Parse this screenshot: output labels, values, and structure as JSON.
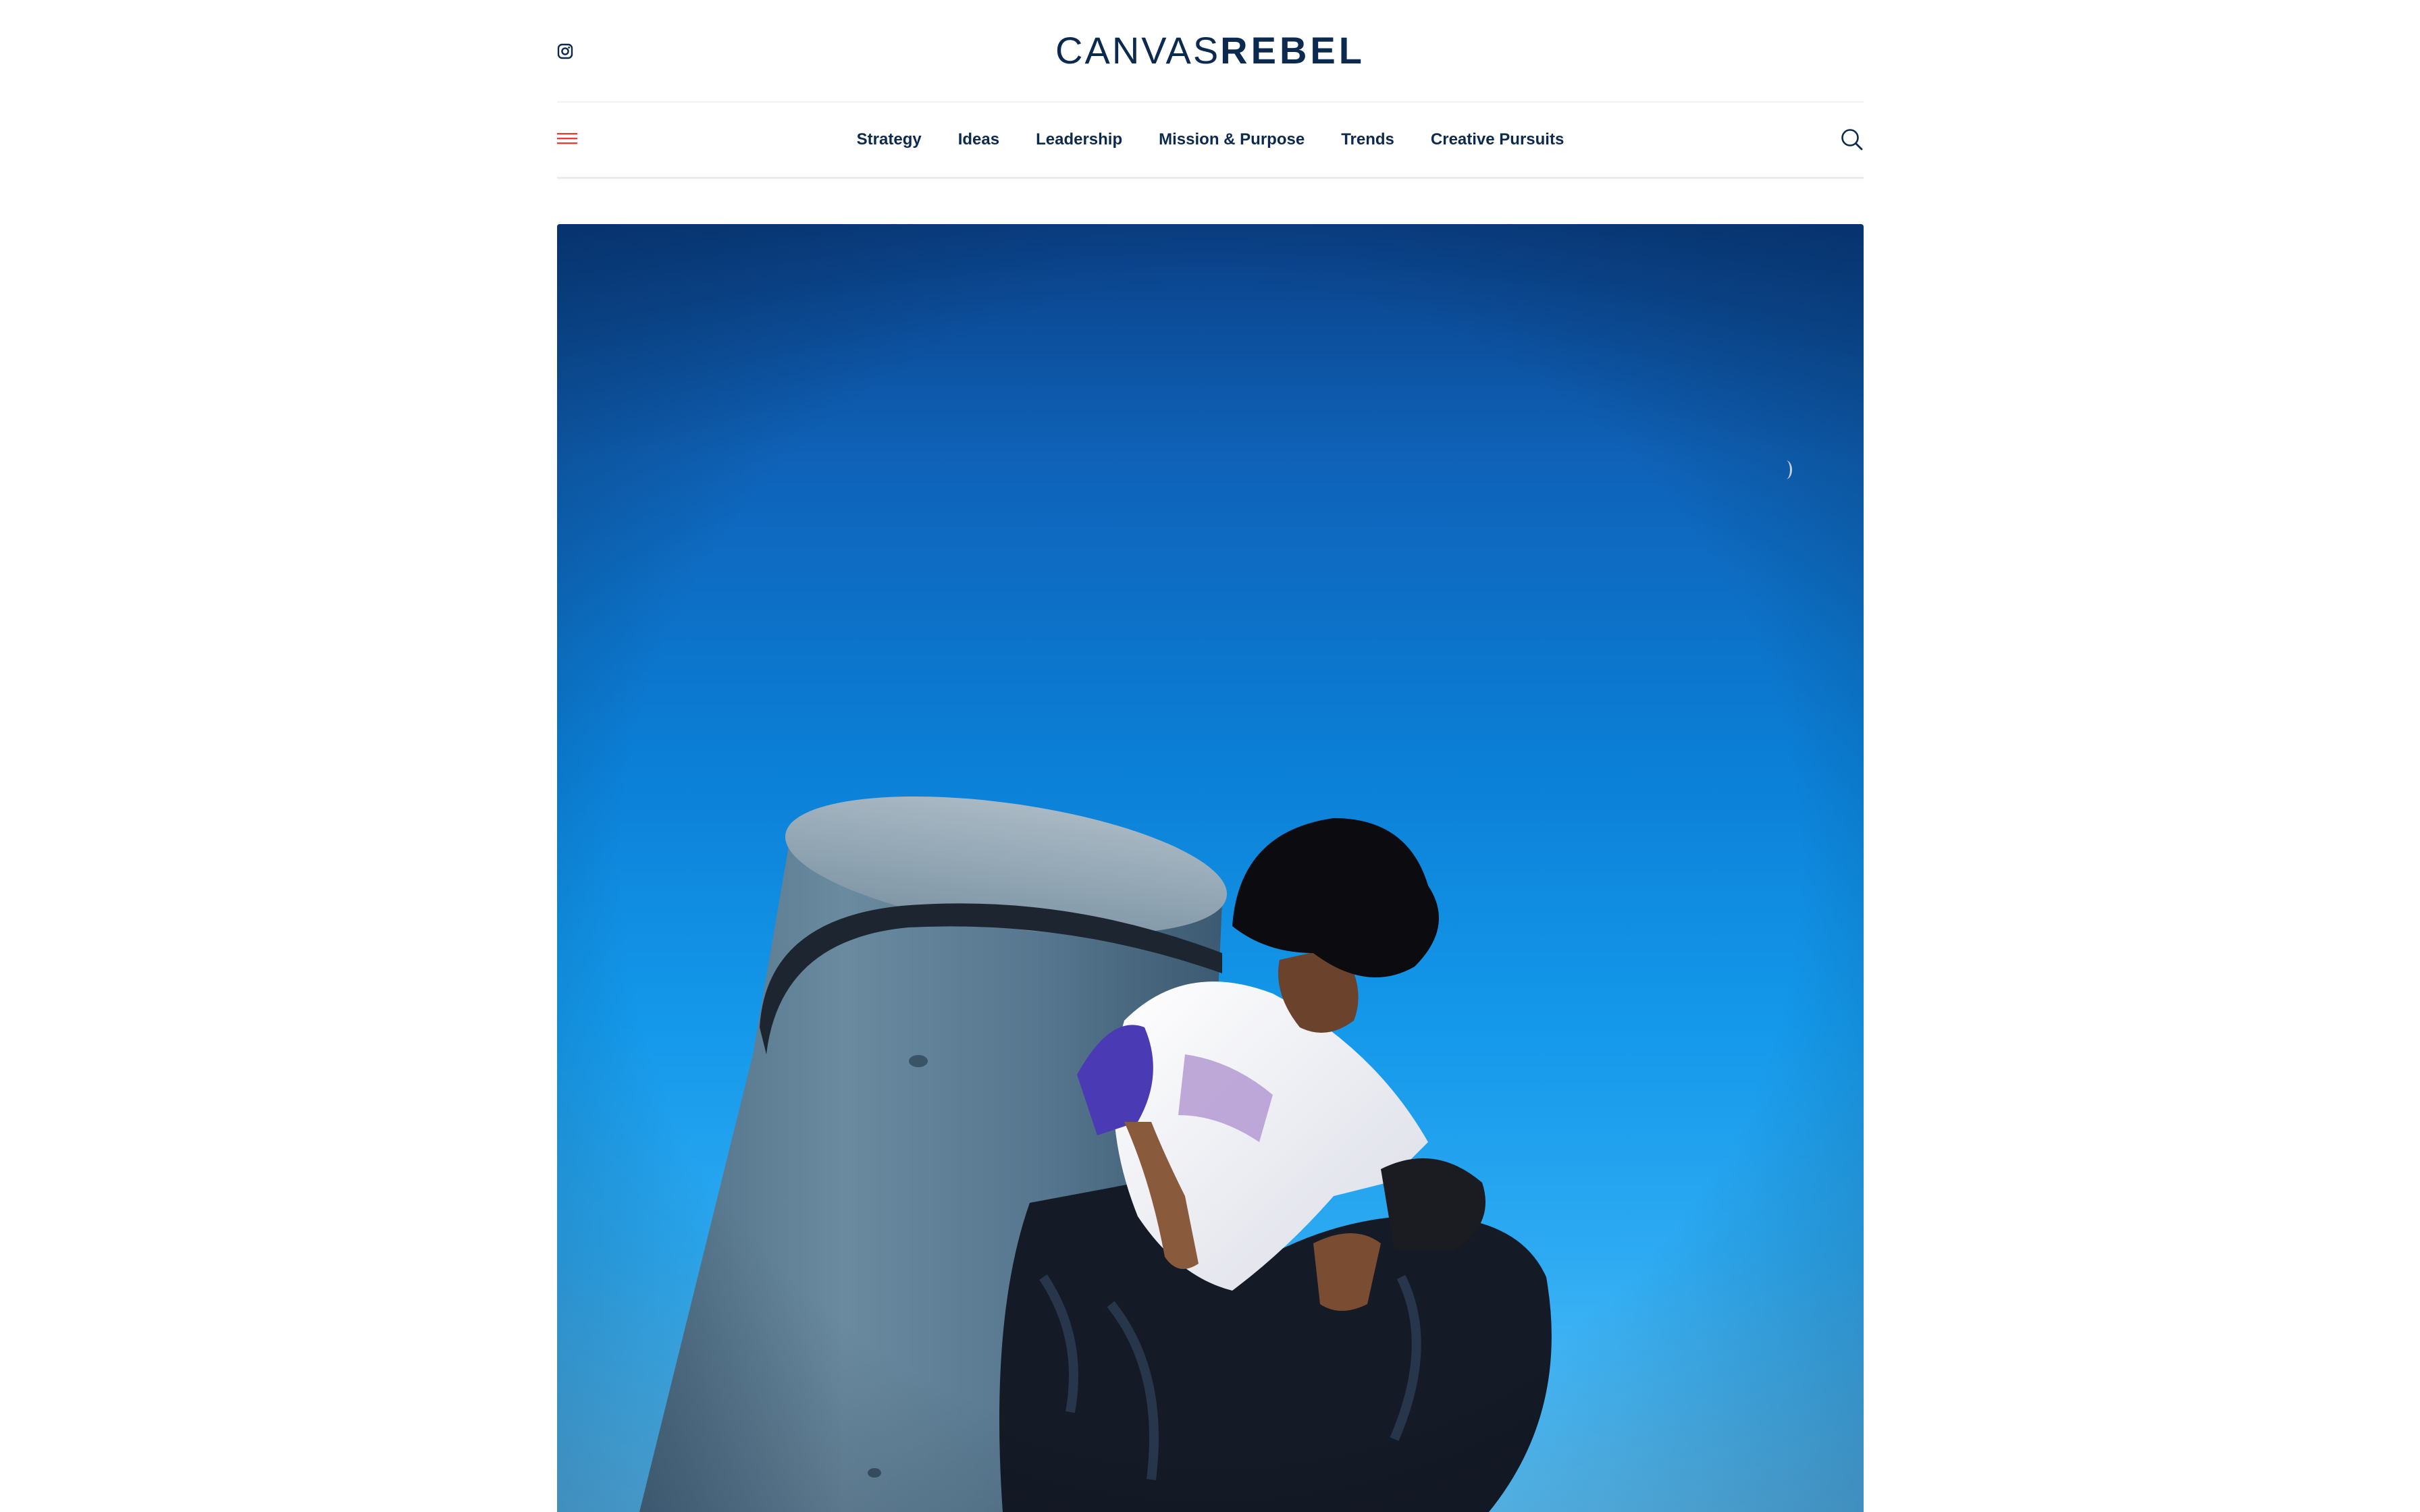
{
  "brand": {
    "logo_light": "CANVAS",
    "logo_bold": "REBEL",
    "logo_color": "#0c2a4f",
    "accent": "#e0403a"
  },
  "header": {
    "social_icon": "instagram-icon",
    "menu_icon": "hamburger-menu-icon",
    "search_icon": "search-icon"
  },
  "nav": {
    "items": [
      {
        "label": "Strategy"
      },
      {
        "label": "Ideas"
      },
      {
        "label": "Leadership"
      },
      {
        "label": "Mission & Purpose"
      },
      {
        "label": "Trends"
      },
      {
        "label": "Creative Pursuits"
      }
    ]
  },
  "hero": {
    "image": "person-in-bucket-hat-crouching-against-blue-sky-photo"
  }
}
